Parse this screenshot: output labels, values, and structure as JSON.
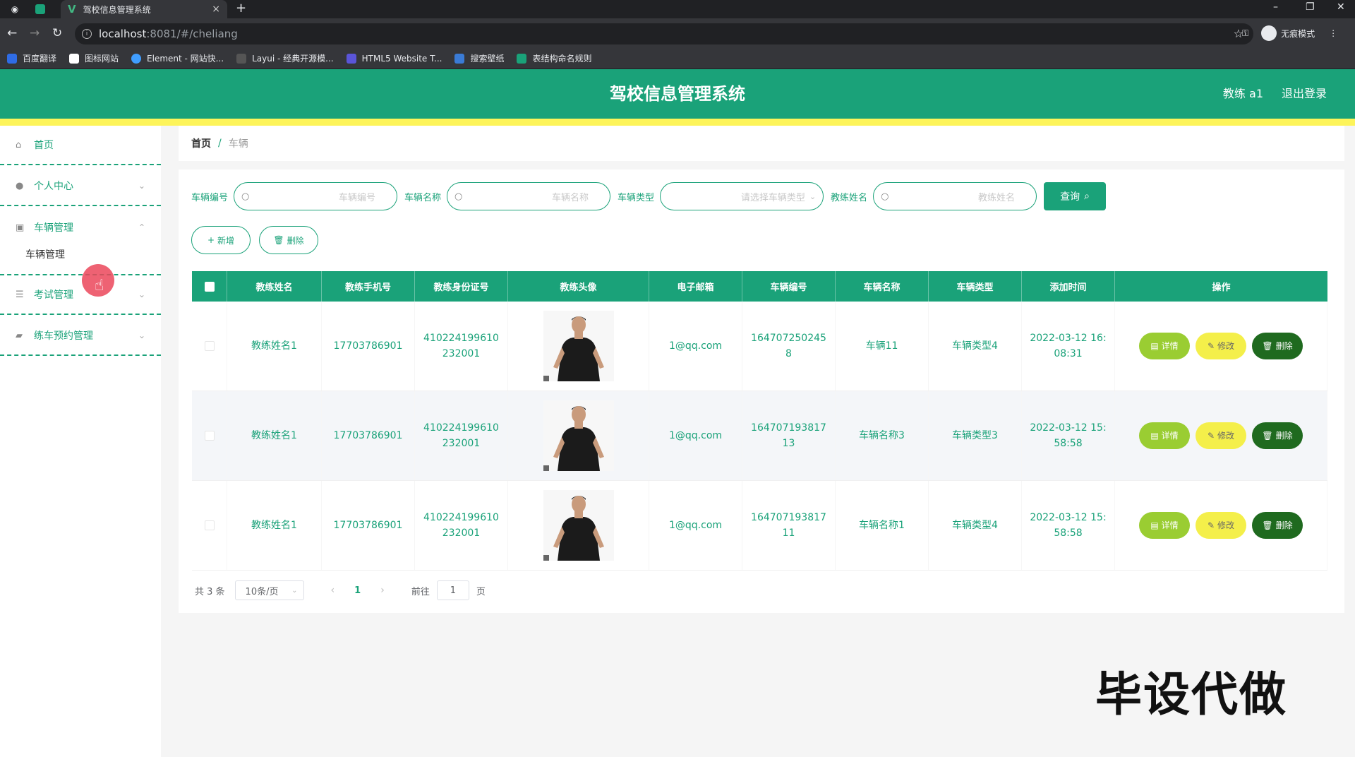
{
  "browser": {
    "tab_title": "驾校信息管理系统",
    "tab_close": "×",
    "new_tab": "+",
    "url_host": "localhost",
    "url_rest": ":8081/#/cheliang",
    "profile_label": "无痕模式",
    "bookmarks": [
      "百度翻译",
      "图标网站",
      "Element - 网站快...",
      "Layui - 经典开源模...",
      "HTML5 Website T...",
      "搜索壁纸",
      "表结构命名规则"
    ]
  },
  "header": {
    "title": "驾校信息管理系统",
    "user": "教练 a1",
    "logout": "退出登录"
  },
  "sidebar": {
    "items": [
      {
        "label": "首页"
      },
      {
        "label": "个人中心"
      },
      {
        "label": "车辆管理"
      },
      {
        "label": "考试管理"
      },
      {
        "label": "练车预约管理"
      }
    ],
    "sub_item": "车辆管理"
  },
  "breadcrumb": {
    "home": "首页",
    "sep": "/",
    "current": "车辆"
  },
  "search": {
    "fields": [
      {
        "label": "车辆编号",
        "placeholder": "车辆编号"
      },
      {
        "label": "车辆名称",
        "placeholder": "车辆名称"
      },
      {
        "label": "车辆类型",
        "placeholder": "请选择车辆类型"
      },
      {
        "label": "教练姓名",
        "placeholder": "教练姓名"
      }
    ],
    "query_label": "查询"
  },
  "actions": {
    "add": "新增",
    "delete": "删除"
  },
  "table": {
    "columns": [
      "教练姓名",
      "教练手机号",
      "教练身份证号",
      "教练头像",
      "电子邮箱",
      "车辆编号",
      "车辆名称",
      "车辆类型",
      "添加时间",
      "操作"
    ],
    "rows": [
      {
        "name": "教练姓名1",
        "phone": "17703786901",
        "idcard": "410224199610232001",
        "email": "1@qq.com",
        "code": "1647072502458",
        "car": "车辆11",
        "type": "车辆类型4",
        "time": "2022-03-12 16:08:31"
      },
      {
        "name": "教练姓名1",
        "phone": "17703786901",
        "idcard": "410224199610232001",
        "email": "1@qq.com",
        "code": "16470719381713",
        "car": "车辆名称3",
        "type": "车辆类型3",
        "time": "2022-03-12 15:58:58"
      },
      {
        "name": "教练姓名1",
        "phone": "17703786901",
        "idcard": "410224199610232001",
        "email": "1@qq.com",
        "code": "16470719381711",
        "car": "车辆名称1",
        "type": "车辆类型4",
        "time": "2022-03-12 15:58:58"
      }
    ],
    "op_detail": "详情",
    "op_edit": "修改",
    "op_delete": "删除"
  },
  "pagination": {
    "total": "共 3 条",
    "page_size": "10条/页",
    "current_page": "1",
    "goto_prefix": "前往",
    "goto_value": "1",
    "goto_suffix": "页"
  },
  "watermark": "毕设代做",
  "colors": {
    "primary": "#1aa279",
    "accent_strip": "#fdf45a",
    "detail": "#9acd32",
    "edit": "#f4ef4a",
    "delete": "#1f6a1f"
  }
}
